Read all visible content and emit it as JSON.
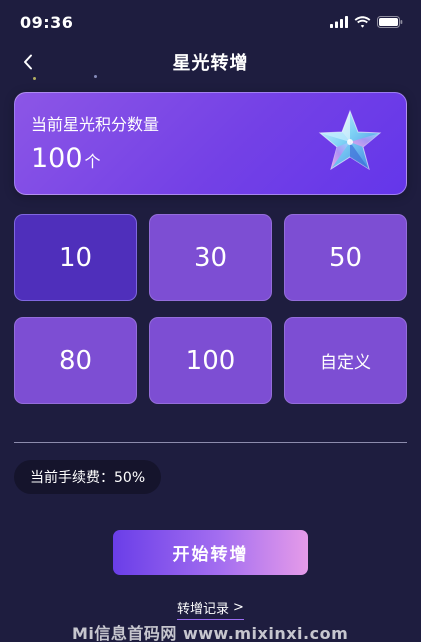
{
  "status_bar": {
    "time": "09:36"
  },
  "nav": {
    "title": "星光转增"
  },
  "points": {
    "label": "当前星光积分数量",
    "value": "100",
    "unit": "个"
  },
  "amounts": [
    {
      "label": "10",
      "selected": true
    },
    {
      "label": "30",
      "selected": false
    },
    {
      "label": "50",
      "selected": false
    },
    {
      "label": "80",
      "selected": false
    },
    {
      "label": "100",
      "selected": false
    },
    {
      "label": "自定义",
      "selected": false
    }
  ],
  "fee": {
    "text": "当前手续费：50%"
  },
  "actions": {
    "start_label": "开始转增",
    "records_label": "转增记录",
    "records_chevron": ">"
  },
  "watermark": {
    "text": "Mi信息首码网 www.mixinxi.com"
  },
  "colors": {
    "background": "#1e1d3f",
    "card_gradient_start": "#8c56e6",
    "card_gradient_end": "#6436ea",
    "tile": "#7d4ed3",
    "tile_selected": "#4f2fbb",
    "button_gradient_start": "#6a3ee8",
    "button_gradient_end": "#e59be9"
  },
  "icons": {
    "back": "chevron-left-icon",
    "star": "crystal-star-icon",
    "signal": "signal-icon",
    "wifi": "wifi-icon",
    "battery": "battery-icon"
  }
}
